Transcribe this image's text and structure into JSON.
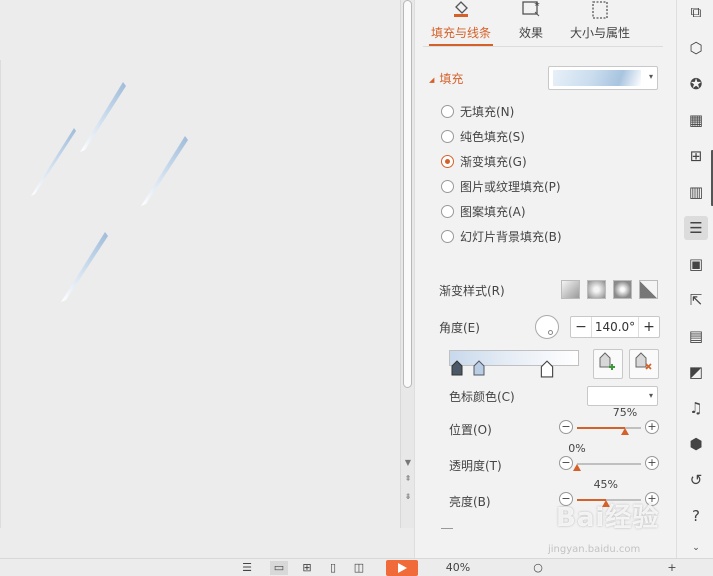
{
  "tabs": [
    {
      "label": "填充与线条",
      "icon": "fill-bucket-icon",
      "active": true
    },
    {
      "label": "效果",
      "icon": "effects-icon",
      "active": false
    },
    {
      "label": "大小与属性",
      "icon": "size-properties-icon",
      "active": false
    }
  ],
  "fill": {
    "section_title": "填充",
    "options": [
      "无填充(N)",
      "纯色填充(S)",
      "渐变填充(G)",
      "图片或纹理填充(P)",
      "图案填充(A)",
      "幻灯片背景填充(B)"
    ],
    "selected_index": 2
  },
  "gradient": {
    "style_label": "渐变样式(R)",
    "angle_label": "角度(E)",
    "angle_value": "140.0°",
    "stop_color_label": "色标颜色(C)",
    "position_label": "位置(O)",
    "position_value": "75%",
    "position_fraction": 0.75,
    "transparency_label": "透明度(T)",
    "transparency_value": "0%",
    "transparency_fraction": 0.0,
    "brightness_label": "亮度(B)",
    "brightness_value": "45%",
    "brightness_fraction": 0.45
  },
  "colors": {
    "accent": "#d5612a",
    "panel_bg": "#f2f2f2",
    "canvas_bg": "#ececec"
  },
  "status_bar": {
    "zoom": "40%"
  },
  "watermark": {
    "text": "Bai经验",
    "sub": "jingyan.baidu.com"
  }
}
